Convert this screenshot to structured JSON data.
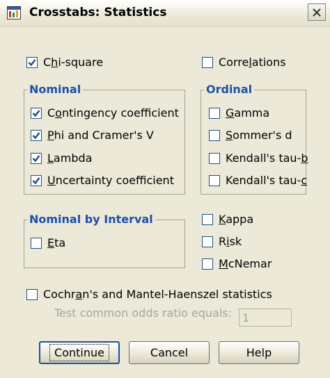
{
  "window": {
    "title": "Crosstabs: Statistics"
  },
  "checkboxes": {
    "chi_square": {
      "pre": "C",
      "ul": "h",
      "post": "i-square",
      "checked": true
    },
    "correlations": {
      "pre": "Corre",
      "ul": "l",
      "post": "ations",
      "checked": false
    },
    "eta": {
      "pre": "",
      "ul": "E",
      "post": "ta",
      "checked": false
    },
    "kappa": {
      "pre": "",
      "ul": "K",
      "post": "appa",
      "checked": false
    },
    "risk": {
      "pre": "R",
      "ul": "i",
      "post": "sk",
      "checked": false
    },
    "mcnemar": {
      "pre": "",
      "ul": "M",
      "post": "cNemar",
      "checked": false
    },
    "cochran": {
      "pre": "Cochr",
      "ul": "a",
      "post": "n's and Mantel-Haenszel statistics",
      "checked": false
    }
  },
  "nominal": {
    "legend": "Nominal",
    "items": [
      {
        "pre": "C",
        "ul": "o",
        "post": "ntingency coefficient",
        "checked": true
      },
      {
        "pre": "",
        "ul": "P",
        "post": "hi and Cramer's V",
        "checked": true
      },
      {
        "pre": "",
        "ul": "L",
        "post": "ambda",
        "checked": true
      },
      {
        "pre": "",
        "ul": "U",
        "post": "ncertainty coefficient",
        "checked": true
      }
    ]
  },
  "ordinal": {
    "legend": "Ordinal",
    "items": [
      {
        "pre": "",
        "ul": "G",
        "post": "amma",
        "checked": false
      },
      {
        "pre": "",
        "ul": "S",
        "post": "ommer's d",
        "checked": false
      },
      {
        "pre": "Kendall's tau-",
        "ul": "b",
        "post": "",
        "checked": false
      },
      {
        "pre": "Kendall's tau-",
        "ul": "c",
        "post": "",
        "checked": false
      }
    ]
  },
  "nominal_by_interval": {
    "legend": "Nominal by Interval"
  },
  "odds_ratio": {
    "label": "Test common odds ratio equals:",
    "value": "1"
  },
  "buttons": {
    "continue": "Continue",
    "cancel": "Cancel",
    "help": "Help"
  },
  "colors": {
    "accent": "#1e4fa8",
    "check": "#1c5180",
    "background": "#ece9d8"
  }
}
